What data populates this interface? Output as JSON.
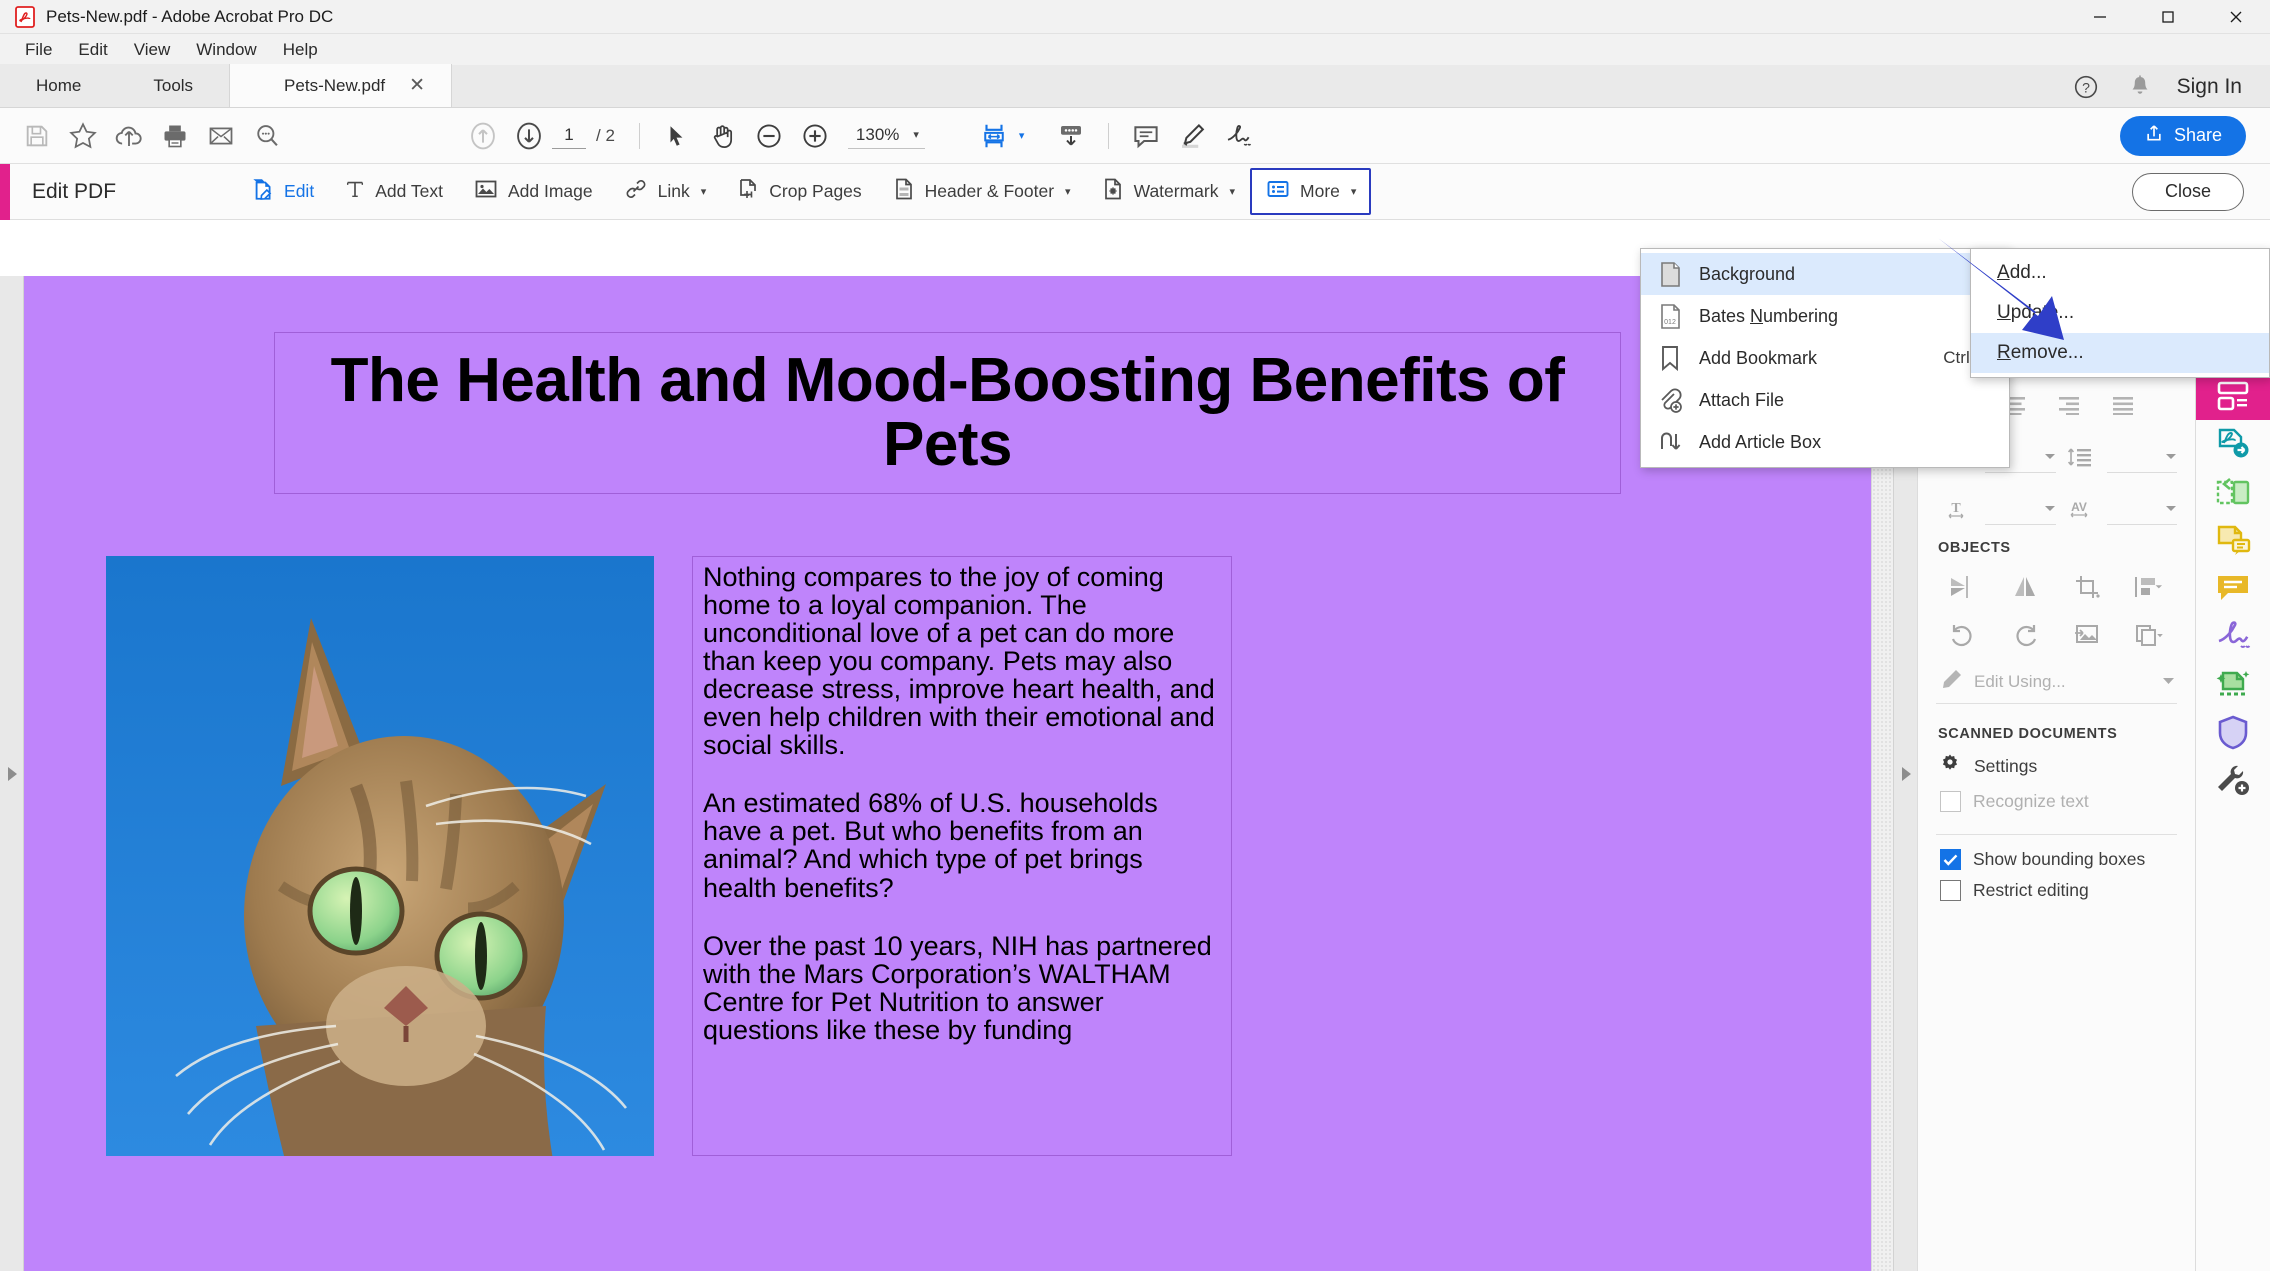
{
  "window": {
    "title": "Pets-New.pdf - Adobe Acrobat Pro DC",
    "minimize": "—",
    "maximize": "▢",
    "close": "✕"
  },
  "menubar": {
    "items": [
      "File",
      "Edit",
      "View",
      "Window",
      "Help"
    ]
  },
  "tabs": {
    "home": "Home",
    "tools": "Tools",
    "document": "Pets-New.pdf",
    "close_glyph": "✕",
    "sign_in": "Sign In"
  },
  "toolbar": {
    "page_current": "1",
    "page_total": "/ 2",
    "zoom_level": "130%",
    "zoom_caret": "▾",
    "share_label": "Share"
  },
  "editbar": {
    "title": "Edit PDF",
    "tools": [
      {
        "label": "Edit",
        "icon": "edit-pdf-icon",
        "caret": ""
      },
      {
        "label": "Add Text",
        "icon": "add-text-icon",
        "caret": ""
      },
      {
        "label": "Add Image",
        "icon": "add-image-icon",
        "caret": ""
      },
      {
        "label": "Link",
        "icon": "link-icon",
        "caret": "▾"
      },
      {
        "label": "Crop Pages",
        "icon": "crop-pages-icon",
        "caret": ""
      },
      {
        "label": "Header & Footer",
        "icon": "header-footer-icon",
        "caret": "▾"
      },
      {
        "label": "Watermark",
        "icon": "watermark-icon",
        "caret": "▾"
      },
      {
        "label": "More",
        "icon": "more-list-icon",
        "caret": "▾"
      }
    ],
    "close_label": "Close"
  },
  "more_menu": {
    "items": [
      {
        "label": "Background",
        "icon": "background-page-icon",
        "shortcut": "",
        "arrow": "▶",
        "highlighted": true
      },
      {
        "label": "Bates Numbering",
        "icon": "bates-numbering-icon",
        "shortcut": "",
        "arrow": "▶",
        "highlighted": false,
        "mnemonic": "N"
      },
      {
        "label": "Add Bookmark",
        "icon": "bookmark-icon",
        "shortcut": "Ctrl+B",
        "arrow": "",
        "highlighted": false
      },
      {
        "label": "Attach File",
        "icon": "attach-file-icon",
        "shortcut": "",
        "arrow": "",
        "highlighted": false
      },
      {
        "label": "Add Article Box",
        "icon": "article-box-icon",
        "shortcut": "",
        "arrow": "",
        "highlighted": false
      }
    ]
  },
  "background_submenu": {
    "items": [
      {
        "label": "Add...",
        "mnemonic": "A",
        "rest": "dd...",
        "highlighted": false
      },
      {
        "label": "Update...",
        "mnemonic": "U",
        "rest": "pdate...",
        "highlighted": false
      },
      {
        "label": "Remove...",
        "mnemonic": "R",
        "rest": "emove...",
        "highlighted": true
      }
    ]
  },
  "document": {
    "background_color": "#bf84fb",
    "title": "The Health and Mood-Boosting Benefits of Pets",
    "image_alt": "cat-photo",
    "paragraphs": [
      "Nothing compares to the joy of coming home to a loyal companion. The unconditional love of a pet can do more than keep you company. Pets may also decrease stress, improve heart health,  and  even  help children  with  their emotional and social skills.",
      "An estimated 68% of U.S. households have a pet. But who benefits from an animal? And which type of pet brings health benefits?",
      "Over  the  past  10  years,  NIH  has partnered with the Mars Corporation’s WALTHAM Centre for  Pet  Nutrition  to answer  questions  like these by funding"
    ]
  },
  "right_panel": {
    "objects_heading": "OBJECTS",
    "edit_using_placeholder": "Edit Using...",
    "scanned_heading": "SCANNED DOCUMENTS",
    "settings_label": "Settings",
    "recognize_text_label": "Recognize text",
    "show_bounding_boxes_label": "Show bounding boxes",
    "restrict_editing_label": "Restrict editing",
    "show_bounding_boxes_checked": true,
    "restrict_editing_checked": false,
    "accent_color": "#1473e6",
    "color_swatch": "#6d6d6d"
  },
  "icon_rail": {
    "items": [
      {
        "name": "create-pdf-icon",
        "active": false
      },
      {
        "name": "combine-files-icon",
        "active": false
      },
      {
        "name": "edit-pdf-icon",
        "active": true
      },
      {
        "name": "export-pdf-icon",
        "active": false
      },
      {
        "name": "organize-pages-icon",
        "active": false
      },
      {
        "name": "fill-and-sign-icon",
        "active": false
      },
      {
        "name": "comment-icon",
        "active": false
      },
      {
        "name": "send-for-signature-icon",
        "active": false
      },
      {
        "name": "enhance-scans-icon",
        "active": false
      },
      {
        "name": "protect-icon",
        "active": false
      },
      {
        "name": "more-tools-icon",
        "active": false
      }
    ],
    "active_color": "#e1218c"
  },
  "annotation": {
    "arrow_color": "#2f3ec8"
  }
}
